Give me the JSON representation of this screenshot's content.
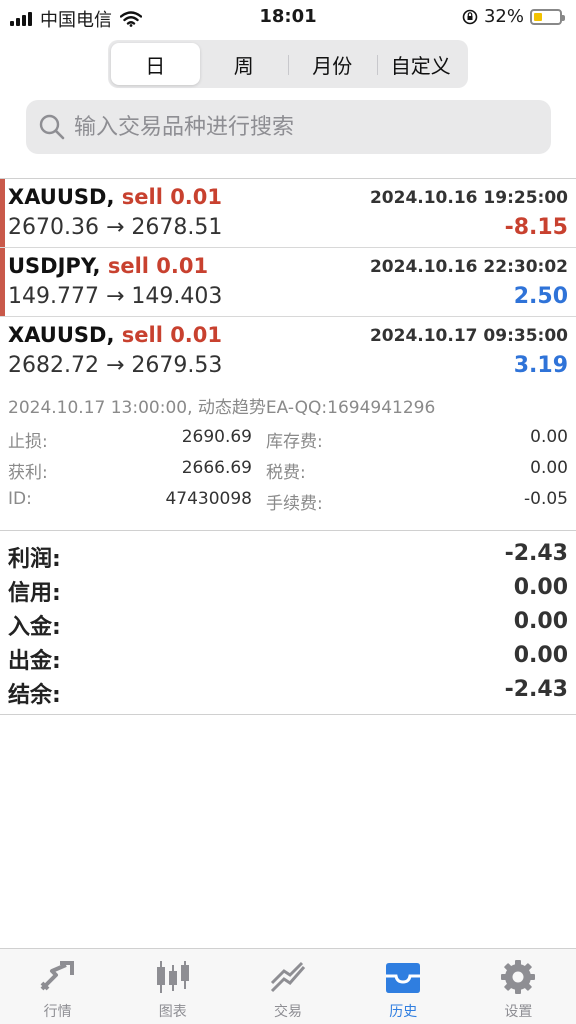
{
  "status_bar": {
    "carrier": "中国电信",
    "time": "18:01",
    "battery_percent": "32%",
    "battery_level": 0.32
  },
  "period_tabs": [
    {
      "label": "日",
      "active": true
    },
    {
      "label": "周",
      "active": false
    },
    {
      "label": "月份",
      "active": false
    },
    {
      "label": "自定义",
      "active": false
    }
  ],
  "search": {
    "placeholder": "输入交易品种进行搜索",
    "icon": "search-icon"
  },
  "trades": [
    {
      "symbol": "XAUUSD,",
      "side": "sell 0.01",
      "time": "2024.10.16 19:25:00",
      "prices": "2670.36 → 2678.51",
      "profit": "-8.15",
      "profit_color": "#c8412f"
    },
    {
      "symbol": "USDJPY,",
      "side": "sell 0.01",
      "time": "2024.10.16 22:30:02",
      "prices": "149.777 → 149.403",
      "profit": "2.50",
      "profit_color": "#2f73d8"
    },
    {
      "symbol": "XAUUSD,",
      "side": "sell 0.01",
      "time": "2024.10.17 09:35:00",
      "prices": "2682.72 → 2679.53",
      "profit": "3.19",
      "profit_color": "#2f73d8",
      "comment": "2024.10.17 13:00:00, 动态趋势EA-QQ:1694941296",
      "details": {
        "sl_label": "止损:",
        "sl_value": "2690.69",
        "swap_label": "库存费:",
        "swap_value": "0.00",
        "tp_label": "获利:",
        "tp_value": "2666.69",
        "tax_label": "税费:",
        "tax_value": "0.00",
        "id_label": "ID:",
        "id_value": "47430098",
        "commission_label": "手续费:",
        "commission_value": "-0.05"
      }
    }
  ],
  "summary": [
    {
      "label": "利润:",
      "value": "-2.43"
    },
    {
      "label": "信用:",
      "value": "0.00"
    },
    {
      "label": "入金:",
      "value": "0.00"
    },
    {
      "label": "出金:",
      "value": "0.00"
    },
    {
      "label": "结余:",
      "value": "-2.43"
    }
  ],
  "tab_bar": [
    {
      "label": "行情",
      "icon": "quotes-icon",
      "active": false
    },
    {
      "label": "图表",
      "icon": "chart-icon",
      "active": false
    },
    {
      "label": "交易",
      "icon": "trade-icon",
      "active": false
    },
    {
      "label": "历史",
      "icon": "history-icon",
      "active": true
    },
    {
      "label": "设置",
      "icon": "settings-icon",
      "active": false
    }
  ],
  "colors": {
    "sell": "#c8412f",
    "negative": "#c8412f",
    "positive": "#2f73d8",
    "active_tab": "#2f7ee0",
    "inactive_tab": "#8e8e93"
  }
}
